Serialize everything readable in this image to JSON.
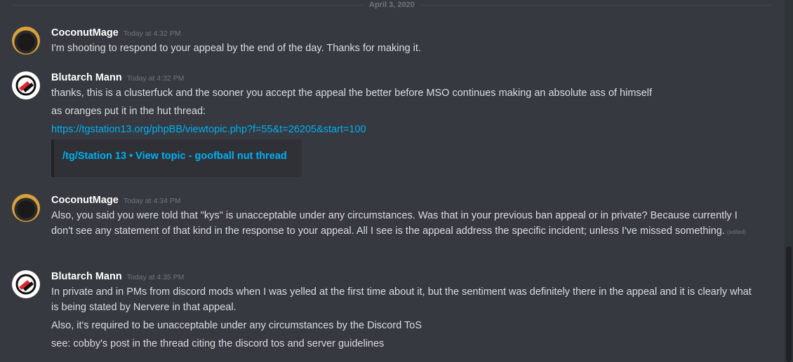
{
  "date_divider": "April 3, 2020",
  "messages": [
    {
      "author": "CoconutMage",
      "timestamp": "Today at 4:32 PM",
      "avatar_icon": "coconutmage-avatar",
      "lines": [
        "I'm shooting to respond to your appeal by the end of the day. Thanks for making it."
      ]
    },
    {
      "author": "Blutarch Mann",
      "timestamp": "Today at 4:32 PM",
      "avatar_icon": "blutarch-avatar",
      "lines": [
        "thanks, this is a clusterfuck and the sooner you accept the appeal the better before MSO continues making an absolute ass of himself",
        "as oranges put it in the hut thread:"
      ],
      "link": "https://tgstation13.org/phpBB/viewtopic.php?f=55&t=26205&start=100",
      "embed_title": "/tg/Station 13 • View topic - goofball nut thread"
    },
    {
      "author": "CoconutMage",
      "timestamp": "Today at 4:34 PM",
      "avatar_icon": "coconutmage-avatar",
      "text": "Also, you said you were told that \"kys\" is unacceptable under any circumstances. Was that in your previous ban appeal or in private? Because currently I don't see any statement of that kind in the response to your appeal. All I see is the appeal address the specific incident; unless I've missed something.",
      "edited": "(edited)"
    },
    {
      "author": "Blutarch Mann",
      "timestamp": "Today at 4:35 PM",
      "avatar_icon": "blutarch-avatar",
      "text": "In private and in PMs from discord mods when I was yelled at the first time about it, but the sentiment was definitely there in the appeal and it is clearly what is being stated by Nervere in that appeal.",
      "lines": [
        "Also, it's required to be unacceptable under any circumstances by the Discord ToS",
        "see: cobby's post in the thread citing the discord tos and server guidelines"
      ]
    }
  ],
  "colors": {
    "background": "#36393f",
    "link": "#00b0f4",
    "author": "#ffffff",
    "text": "#dcddde",
    "muted": "#72767d"
  }
}
